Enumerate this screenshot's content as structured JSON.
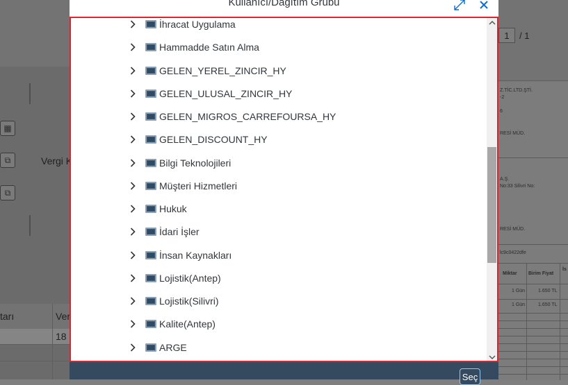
{
  "dialog": {
    "title": "Kullanıcı/Dağıtım Grubu",
    "select_button": "Seç"
  },
  "tree_items": [
    {
      "label": "İhracat Uygulama"
    },
    {
      "label": "Hammadde Satın Alma"
    },
    {
      "label": "GELEN_YEREL_ZINCIR_HY"
    },
    {
      "label": "GELEN_ULUSAL_ZINCIR_HY"
    },
    {
      "label": "GELEN_MIGROS_CARREFOURSA_HY"
    },
    {
      "label": "GELEN_DISCOUNT_HY"
    },
    {
      "label": "Bilgi Teknolojileri"
    },
    {
      "label": "Müşteri Hizmetleri"
    },
    {
      "label": "Hukuk"
    },
    {
      "label": "İdari İşler"
    },
    {
      "label": "İnsan Kaynakları"
    },
    {
      "label": "Lojistik(Antep)"
    },
    {
      "label": "Lojistik(Silivri)"
    },
    {
      "label": "Kalite(Antep)"
    },
    {
      "label": "ARGE"
    }
  ],
  "background": {
    "left_label": "Vergi K",
    "table_header_1": "tarı",
    "table_header_2": "Ver",
    "table_value": "18",
    "pager_current": "1",
    "pager_total": "/ 1",
    "doc_lines": [
      "Z.TİC.LTD.ŞTİ.",
      "-2",
      "6",
      "RESİ MÜD.",
      "A.Ş.",
      "No:33 Silivri  No:",
      "RESİ MÜD.",
      "lc9c0422dfe"
    ],
    "doc_table_headers": [
      "Miktar",
      "Birim Fiyat",
      "İs"
    ],
    "doc_table_rows": [
      [
        "1 Gün",
        "1.650 TL"
      ],
      [
        "1 Gün",
        "1.650 TL"
      ]
    ]
  },
  "colors": {
    "frame_highlight": "#d9252c",
    "footer": "#354a5f",
    "accent": "#0a6ed1"
  }
}
